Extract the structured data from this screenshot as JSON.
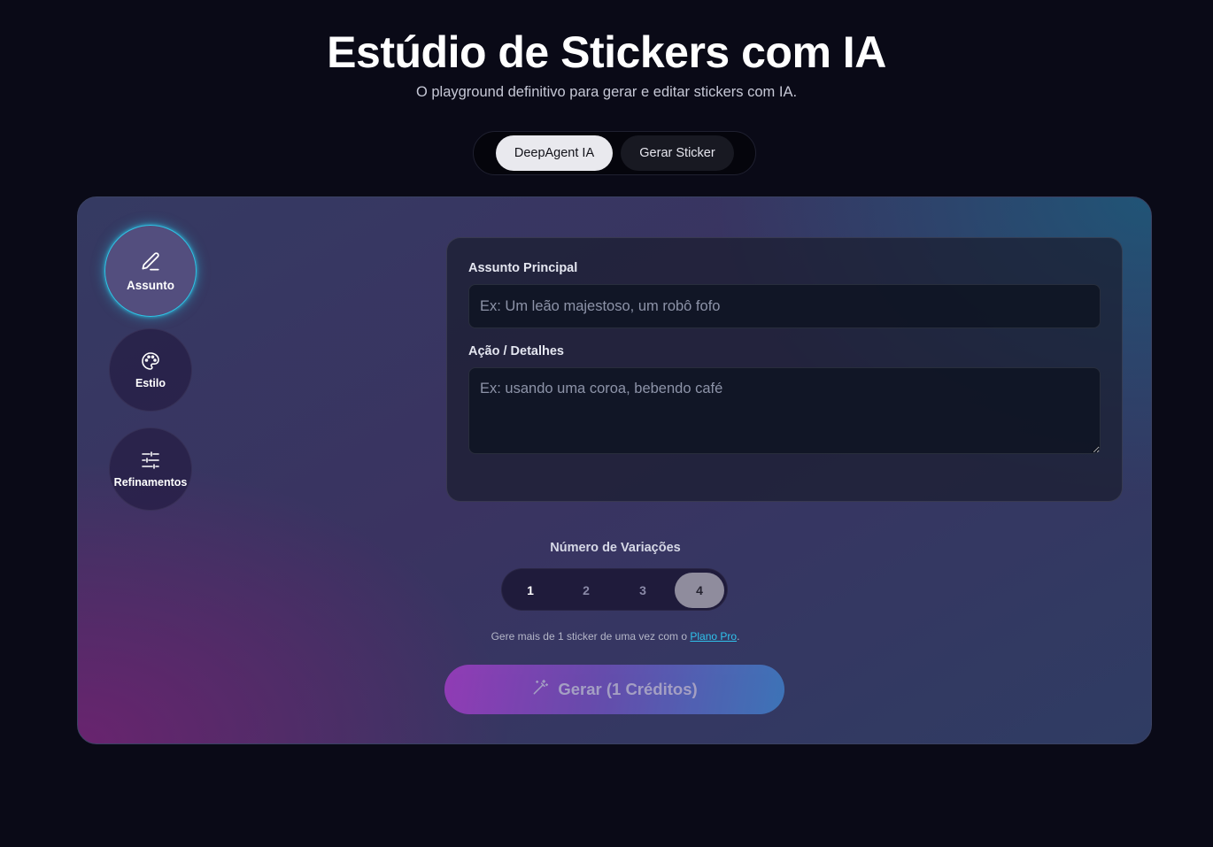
{
  "header": {
    "title": "Estúdio de Stickers com IA",
    "subtitle": "O playground definitivo para gerar e editar stickers com IA."
  },
  "mode_switch": {
    "options": [
      {
        "label": "DeepAgent IA",
        "active": true
      },
      {
        "label": "Gerar Sticker",
        "active": false
      }
    ]
  },
  "sidebar": {
    "items": [
      {
        "label": "Assunto",
        "icon": "pencil-icon",
        "active": true
      },
      {
        "label": "Estilo",
        "icon": "palette-icon",
        "active": false
      },
      {
        "label": "Refinamentos",
        "icon": "sliders-icon",
        "active": false
      }
    ]
  },
  "form": {
    "subject": {
      "label": "Assunto Principal",
      "value": "",
      "placeholder": "Ex: Um leão majestoso, um robô fofo"
    },
    "details": {
      "label": "Ação / Detalhes",
      "value": "",
      "placeholder": "Ex: usando uma coroa, bebendo café"
    }
  },
  "variations": {
    "label": "Número de Variações",
    "options": [
      "1",
      "2",
      "3",
      "4"
    ],
    "selected": "4"
  },
  "upsell": {
    "text_before": "Gere mais de 1 sticker de uma vez com o ",
    "link_text": "Plano Pro",
    "text_after": "."
  },
  "generate": {
    "label": "Gerar (1 Créditos)",
    "icon": "magic-wand-icon"
  },
  "colors": {
    "background": "#0a0a17",
    "accent_cyan": "#2ec4e6",
    "link": "#2fc2ec"
  }
}
